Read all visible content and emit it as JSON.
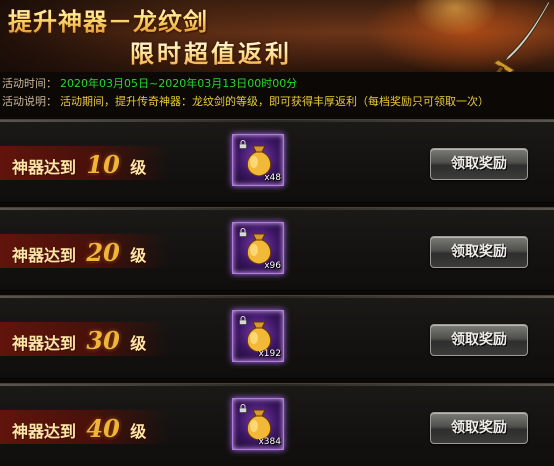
{
  "banner": {
    "title": "提升神器－龙纹剑",
    "subtitle": "限时超值返利"
  },
  "info": {
    "time_label": "活动时间：",
    "time_value": "2020年03月05日~2020年03月13日00时00分",
    "desc_label": "活动说明：",
    "desc_value": "活动期间，提升传奇神器：龙纹剑的等级，即可获得丰厚返利（每档奖励只可领取一次）"
  },
  "colors": {
    "time_text": "#29d729",
    "desc_text": "#e8cc38",
    "level_number": "#f0b63a",
    "item_border": "#b27be0"
  },
  "rewards": [
    {
      "prefix": "神器达到",
      "level": "10",
      "suffix": "级",
      "item_icon": "gold-sack-icon",
      "quantity": "x48",
      "button": "领取奖励"
    },
    {
      "prefix": "神器达到",
      "level": "20",
      "suffix": "级",
      "item_icon": "gold-sack-icon",
      "quantity": "x96",
      "button": "领取奖励"
    },
    {
      "prefix": "神器达到",
      "level": "30",
      "suffix": "级",
      "item_icon": "gold-sack-icon",
      "quantity": "x192",
      "button": "领取奖励"
    },
    {
      "prefix": "神器达到",
      "level": "40",
      "suffix": "级",
      "item_icon": "gold-sack-icon",
      "quantity": "x384",
      "button": "领取奖励"
    }
  ]
}
